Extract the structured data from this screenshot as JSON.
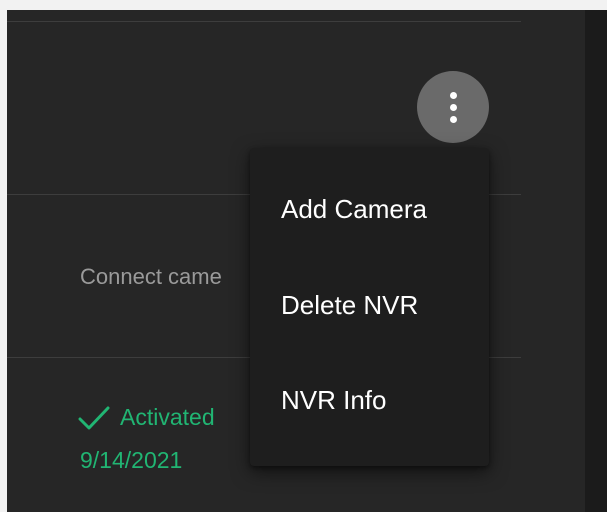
{
  "row_actions": {
    "more_button_icon": "more-vertical-icon"
  },
  "rows": [
    {
      "description": "Connect came"
    },
    {
      "status_label": "Activated",
      "status_date": "9/14/2021",
      "status_icon": "check-icon",
      "status_color": "#21b573"
    }
  ],
  "menu": {
    "items": [
      {
        "label": "Add Camera"
      },
      {
        "label": "Delete NVR"
      },
      {
        "label": "NVR Info"
      }
    ]
  },
  "colors": {
    "panel_bg": "#262626",
    "menu_bg": "#1e1e1e",
    "menu_text": "#ffffff",
    "muted_text": "#9a9a9a",
    "success": "#21b573",
    "button_bg": "#6a6a6a"
  }
}
